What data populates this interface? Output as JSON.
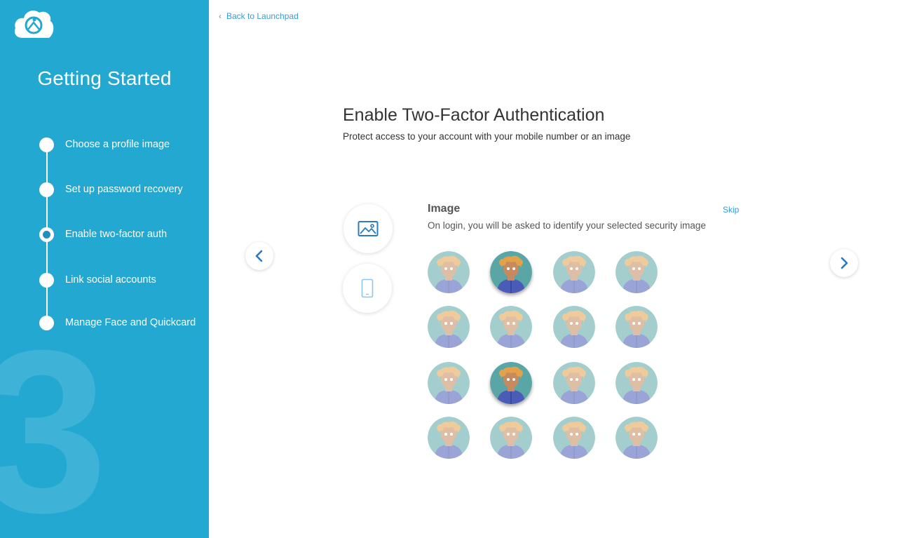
{
  "sidebar": {
    "title": "Getting Started",
    "big_number": "3",
    "steps": [
      {
        "label": "Choose a profile image",
        "active": false
      },
      {
        "label": "Set up password recovery",
        "active": false
      },
      {
        "label": "Enable two-factor auth",
        "active": true
      },
      {
        "label": "Link social accounts",
        "active": false
      },
      {
        "label": "Manage Face and Quickcard",
        "active": false
      }
    ]
  },
  "header": {
    "back_label": "Back to Launchpad"
  },
  "main": {
    "title": "Enable Two-Factor Authentication",
    "subtitle": "Protect access to  your account  with your mobile number or an image",
    "methods": [
      {
        "name": "image",
        "icon": "image-icon"
      },
      {
        "name": "mobile",
        "icon": "mobile-phone-icon"
      }
    ],
    "section": {
      "title": "Image",
      "description": "On login, you will be asked to identify your selected security image",
      "skip_label": "Skip"
    },
    "avatars": [
      {
        "selected": false
      },
      {
        "selected": true
      },
      {
        "selected": false
      },
      {
        "selected": false
      },
      {
        "selected": false
      },
      {
        "selected": false
      },
      {
        "selected": false
      },
      {
        "selected": false
      },
      {
        "selected": false
      },
      {
        "selected": true
      },
      {
        "selected": false
      },
      {
        "selected": false
      },
      {
        "selected": false
      },
      {
        "selected": false
      },
      {
        "selected": false
      },
      {
        "selected": false
      }
    ]
  },
  "colors": {
    "sidebar_bg": "#22a8d1",
    "accent": "#3a9bd5",
    "avatar_bg": "#5aa6a6",
    "avatar_hair": "#e3a24a",
    "avatar_skin": "#c68a5e",
    "avatar_shirt": "#4a5bb8"
  }
}
